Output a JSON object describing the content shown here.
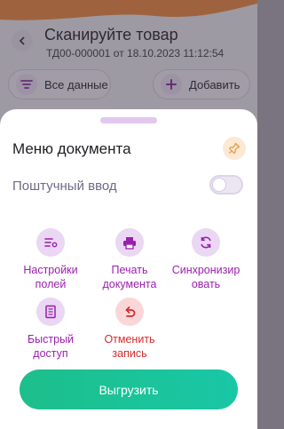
{
  "background": {
    "title": "Сканируйте товар",
    "subtitle": "ТД00-000001 от 18.10.2023 11:12:54",
    "chip_all": "Все данные",
    "chip_add": "Добавить"
  },
  "sheet": {
    "title": "Меню документа",
    "toggle_label": "Поштучный ввод",
    "toggle_on": false,
    "actions": [
      {
        "label": "Настройки\nполей",
        "icon": "sliders-icon"
      },
      {
        "label": "Печать\nдокумента",
        "icon": "printer-icon"
      },
      {
        "label": "Синхронизир\nовать",
        "icon": "sync-icon"
      },
      {
        "label": "Быстрый\nдоступ",
        "icon": "document-icon"
      },
      {
        "label": "Отменить\nзапись",
        "icon": "undo-icon"
      }
    ],
    "upload_label": "Выгрузить"
  },
  "colors": {
    "accent": "#9b1fae",
    "danger": "#d52b2b",
    "primary_button": "#1dbf8b",
    "icon_bg": "#ead7f3",
    "danger_bg": "#fbd6d8"
  }
}
